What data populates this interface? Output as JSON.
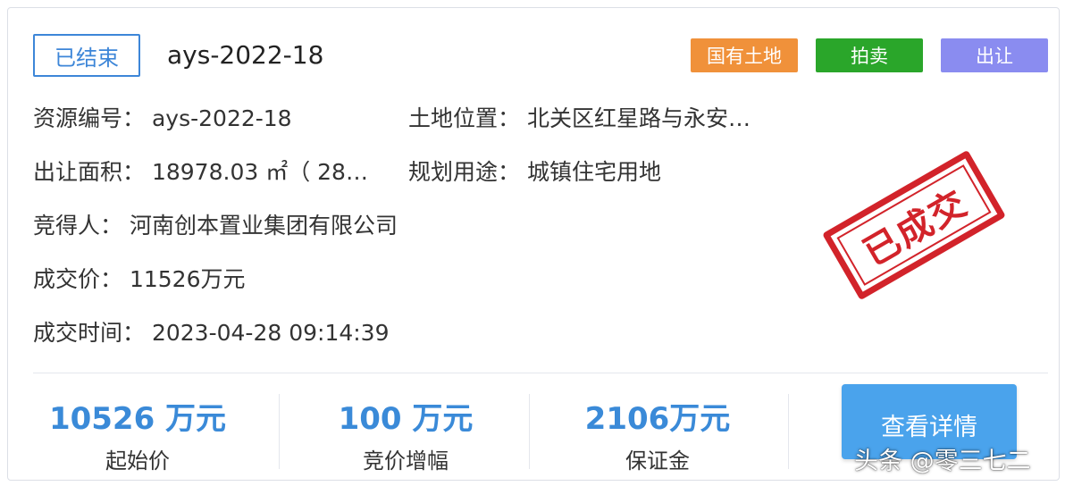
{
  "header": {
    "status": "已结束",
    "title": "ays-2022-18",
    "badges": [
      "国有土地",
      "拍卖",
      "出让"
    ]
  },
  "info": {
    "resource_no_label": "资源编号：",
    "resource_no": "ays-2022-18",
    "location_label": "土地位置：",
    "location": "北关区红星路与永安…",
    "area_label": "出让面积：",
    "area": "18978.03 ㎡（ 28…",
    "usage_label": "规划用途：",
    "usage": "城镇住宅用地",
    "winner_label": "竞得人：",
    "winner": "河南创本置业集团有限公司",
    "price_label": "成交价：",
    "price": "11526万元",
    "time_label": "成交时间：",
    "time": "2023-04-28 09:14:39"
  },
  "stamp": "已成交",
  "stats": [
    {
      "value": "10526 万元",
      "caption": "起始价"
    },
    {
      "value": "100 万元",
      "caption": "竞价增幅"
    },
    {
      "value": "2106万元",
      "caption": "保证金"
    }
  ],
  "detail_button": "查看详情",
  "watermark": "头条 @零三七二",
  "colors": {
    "accent": "#3a8ad8",
    "badge_owned": "#f0913a",
    "badge_auction": "#2aa62a",
    "badge_transfer": "#8a8cf0",
    "stamp": "#d2232a",
    "button": "#4aa3ec"
  }
}
